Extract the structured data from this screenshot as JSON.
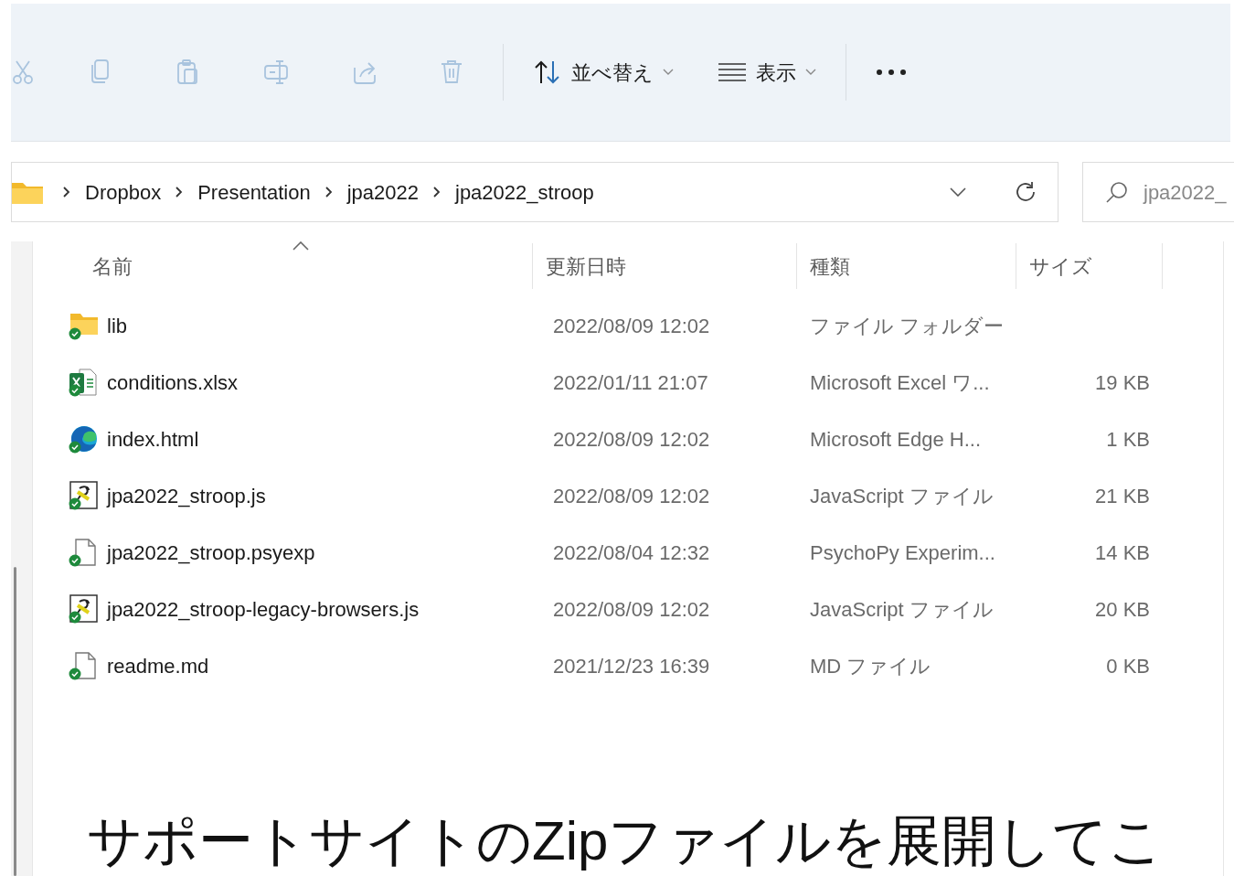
{
  "toolbar": {
    "actions": [
      {
        "kind": "cut",
        "disabled": true
      },
      {
        "kind": "copy",
        "disabled": true
      },
      {
        "kind": "paste",
        "disabled": true
      },
      {
        "kind": "rename",
        "disabled": true
      },
      {
        "kind": "share",
        "disabled": true
      },
      {
        "kind": "delete",
        "disabled": true
      }
    ],
    "sort_button": {
      "label": "並べ替え"
    },
    "view_button": {
      "label": "表示"
    }
  },
  "address_bar": {
    "breadcrumbs": [
      "Dropbox",
      "Presentation",
      "jpa2022",
      "jpa2022_stroop"
    ]
  },
  "search": {
    "placeholder": "jpa2022_"
  },
  "columns": [
    {
      "label": "名前",
      "sorted": true
    },
    {
      "label": "更新日時",
      "sorted": false
    },
    {
      "label": "種類",
      "sorted": false
    },
    {
      "label": "サイズ",
      "sorted": false
    }
  ],
  "rows": [
    {
      "kind": "folder",
      "name": "lib",
      "modified": "2022/08/09 12:02",
      "type": "ファイル フォルダー",
      "synced": true
    },
    {
      "kind": "excel",
      "name": "conditions.xlsx",
      "modified": "2022/01/11 21:07",
      "type": "Microsoft Excel ワ...",
      "size": "19 KB",
      "synced": true
    },
    {
      "kind": "edge",
      "name": "index.html",
      "modified": "2022/08/09 12:02",
      "type": "Microsoft Edge H...",
      "size": "1 KB",
      "synced": true
    },
    {
      "kind": "script",
      "name": "jpa2022_stroop.js",
      "modified": "2022/08/09 12:02",
      "type": "JavaScript ファイル",
      "size": "21 KB",
      "synced": true
    },
    {
      "kind": "file",
      "name": "jpa2022_stroop.psyexp",
      "modified": "2022/08/04 12:32",
      "type": "PsychoPy Experim...",
      "size": "14 KB",
      "synced": true
    },
    {
      "kind": "script",
      "name": "jpa2022_stroop-legacy-browsers.js",
      "modified": "2022/08/09 12:02",
      "type": "JavaScript ファイル",
      "size": "20 KB",
      "synced": true
    },
    {
      "kind": "file",
      "name": "readme.md",
      "modified": "2021/12/23 16:39",
      "type": "MD ファイル",
      "size": "0 KB",
      "synced": true
    }
  ],
  "caption": "サポートサイトのZipファイルを展開してこ"
}
